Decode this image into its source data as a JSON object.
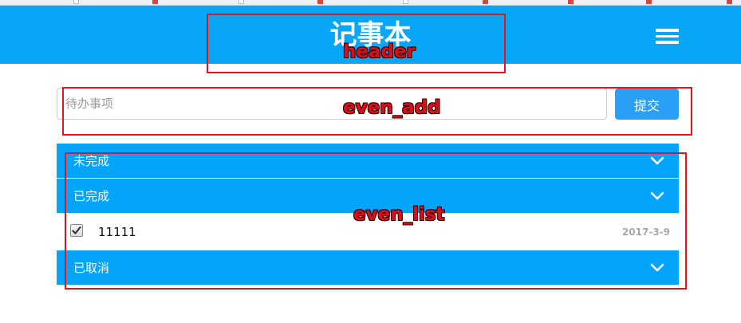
{
  "header": {
    "title": "记事本",
    "menu_icon": "hamburger-menu-icon",
    "background": "#08a6f7"
  },
  "add_form": {
    "placeholder": "待办事项",
    "value": "",
    "submit_label": "提交",
    "submit_color": "#29a0f5"
  },
  "sections": [
    {
      "label": "未完成",
      "icon": "chevron-down-icon"
    },
    {
      "label": "已完成",
      "icon": "chevron-down-icon"
    },
    {
      "label": "已取消",
      "icon": "chevron-down-icon"
    }
  ],
  "completed_items": [
    {
      "text": "11111",
      "date": "2017-3-9",
      "checked": true
    }
  ],
  "annotations": {
    "header": "header",
    "add": "even_add",
    "list": "even_list",
    "color": "#e4141b"
  }
}
